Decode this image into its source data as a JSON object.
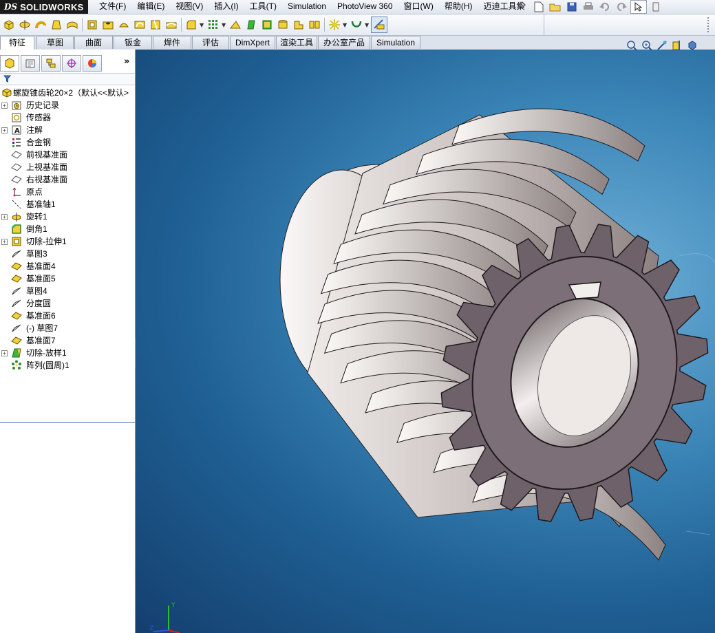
{
  "app": {
    "brand_mark": "DS",
    "brand_name": "SOLIDWORKS"
  },
  "menu": [
    "文件(F)",
    "编辑(E)",
    "视图(V)",
    "插入(I)",
    "工具(T)",
    "Simulation",
    "PhotoView 360",
    "窗口(W)",
    "帮助(H)",
    "迈迪工具集"
  ],
  "command_tabs": [
    "特征",
    "草图",
    "曲面",
    "钣金",
    "焊件",
    "评估",
    "DimXpert",
    "渲染工具",
    "办公室产品",
    "Simulation"
  ],
  "active_tab": "特征",
  "feature_tree": {
    "root": "螺旋锥齿轮20×2（默认<<默认>",
    "items": [
      {
        "label": "历史记录",
        "icon": "history-icon",
        "expandable": true
      },
      {
        "label": "传感器",
        "icon": "sensor-icon",
        "expandable": false
      },
      {
        "label": "注解",
        "icon": "annotation-icon",
        "expandable": true
      },
      {
        "label": "合金钢",
        "icon": "material-icon",
        "expandable": false
      },
      {
        "label": "前视基准面",
        "icon": "plane-icon",
        "expandable": false
      },
      {
        "label": "上视基准面",
        "icon": "plane-icon",
        "expandable": false
      },
      {
        "label": "右视基准面",
        "icon": "plane-icon",
        "expandable": false
      },
      {
        "label": "原点",
        "icon": "origin-icon",
        "expandable": false
      },
      {
        "label": "基准轴1",
        "icon": "axis-icon",
        "expandable": false
      },
      {
        "label": "旋转1",
        "icon": "revolve-icon",
        "expandable": true
      },
      {
        "label": "倒角1",
        "icon": "chamfer-icon",
        "expandable": false
      },
      {
        "label": "切除-拉伸1",
        "icon": "cut-extrude-icon",
        "expandable": true
      },
      {
        "label": "草图3",
        "icon": "sketch-icon",
        "expandable": false
      },
      {
        "label": "基准面4",
        "icon": "ref-plane-icon",
        "expandable": false
      },
      {
        "label": "基准面5",
        "icon": "ref-plane-icon",
        "expandable": false
      },
      {
        "label": "草图4",
        "icon": "sketch-icon",
        "expandable": false
      },
      {
        "label": "分度圆",
        "icon": "sketch-icon",
        "expandable": false
      },
      {
        "label": "基准面6",
        "icon": "ref-plane-icon",
        "expandable": false
      },
      {
        "label": "(-) 草图7",
        "icon": "sketch-icon",
        "expandable": false
      },
      {
        "label": "基准面7",
        "icon": "ref-plane-icon",
        "expandable": false
      },
      {
        "label": "切除-放样1",
        "icon": "cut-loft-icon",
        "expandable": true
      },
      {
        "label": "阵列(圆周)1",
        "icon": "circular-pattern-icon",
        "expandable": false
      }
    ]
  },
  "colors": {
    "accent": "#2b6cb0",
    "gear_body": "#d9d3d0",
    "gear_face": "#7d6f78",
    "viewport_top": "#6fb0d8",
    "viewport_bottom": "#143f6e"
  },
  "triad": {
    "x_label": "",
    "y_label": "Y",
    "z_label": "Z"
  }
}
